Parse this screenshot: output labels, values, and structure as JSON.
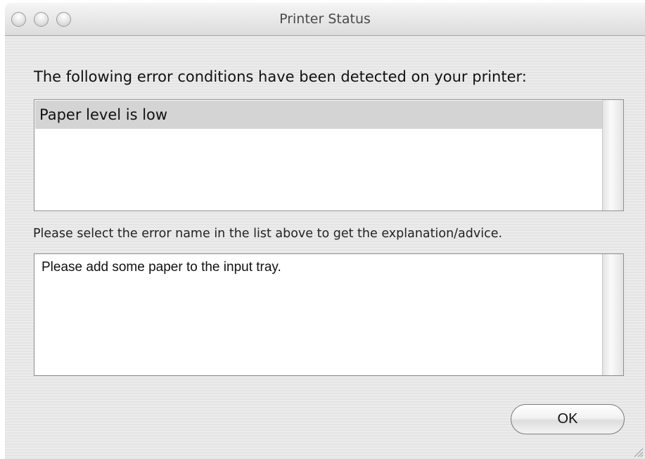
{
  "window": {
    "title": "Printer Status"
  },
  "main": {
    "heading": "The following error conditions have been detected on your printer:",
    "errors": [
      "Paper level is low"
    ],
    "hint": "Please select the error name in the list above to get the explanation/advice.",
    "advice": "Please add some paper to the input tray."
  },
  "buttons": {
    "ok_label": "OK"
  },
  "icons": {
    "close": "close-button-icon",
    "minimize": "minimize-button-icon",
    "zoom": "zoom-button-icon",
    "resize": "resize-grip-icon"
  },
  "colors": {
    "selection": "#d4d4d4",
    "window_bg": "#ececec"
  }
}
